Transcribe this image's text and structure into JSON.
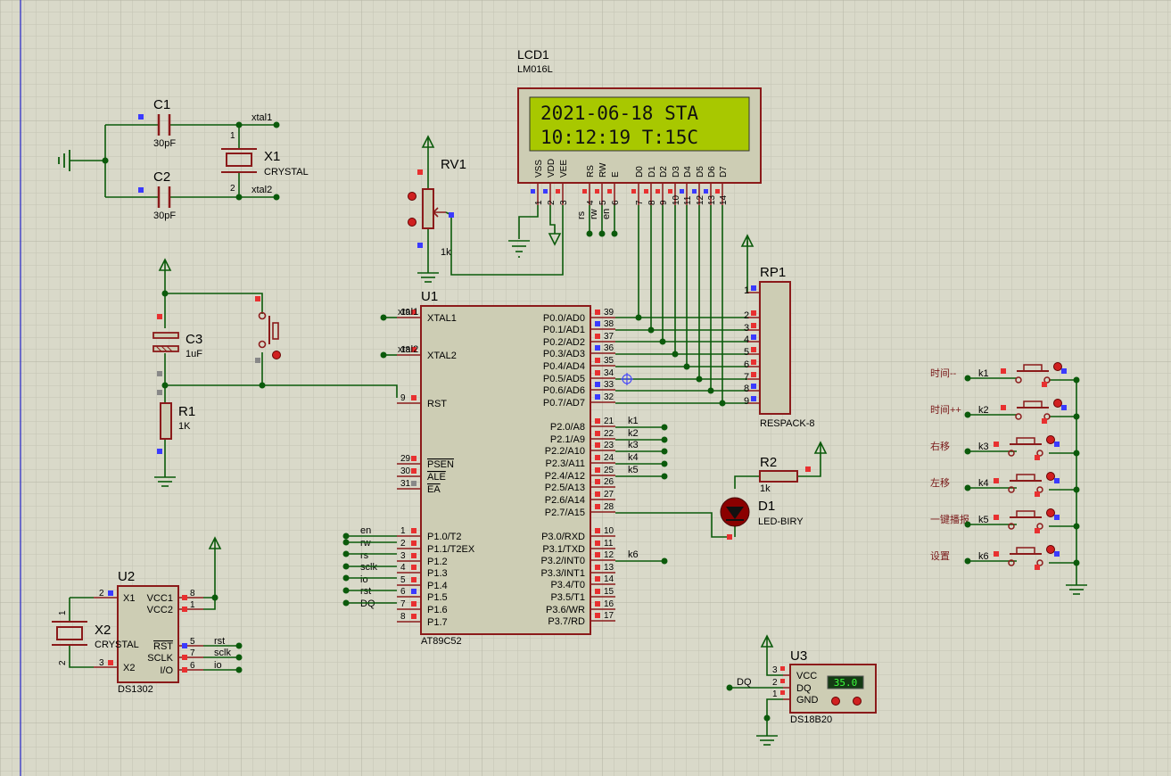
{
  "lcd": {
    "ref": "LCD1",
    "model": "LM016L",
    "line1": "2021-06-18 STA",
    "line2": "10:12:19   T:15C",
    "pin_names": [
      "VSS",
      "VDD",
      "VEE",
      "RS",
      "RW",
      "E",
      "D0",
      "D1",
      "D2",
      "D3",
      "D4",
      "D5",
      "D6",
      "D7"
    ],
    "pin_numbers": [
      "1",
      "2",
      "3",
      "4",
      "5",
      "6",
      "7",
      "8",
      "9",
      "10",
      "11",
      "12",
      "13",
      "14"
    ],
    "net_rs": "rs",
    "net_rw": "rw",
    "net_en": "en"
  },
  "c1": {
    "ref": "C1",
    "value": "30pF"
  },
  "c2": {
    "ref": "C2",
    "value": "30pF"
  },
  "x1": {
    "ref": "X1",
    "value": "CRYSTAL",
    "net1": "xtal1",
    "net2": "xtal2",
    "pin1": "1",
    "pin2": "2"
  },
  "rv1": {
    "ref": "RV1",
    "value": "1k"
  },
  "c3": {
    "ref": "C3",
    "value": "1uF"
  },
  "r1": {
    "ref": "R1",
    "value": "1K"
  },
  "u1": {
    "ref": "U1",
    "part": "AT89C52",
    "left_pins": [
      {
        "name": "XTAL1",
        "num": "19",
        "net": "xtal1"
      },
      {
        "name": "XTAL2",
        "num": "18",
        "net": "xtal2"
      },
      {
        "name": "RST",
        "num": "9",
        "net": ""
      },
      {
        "name": "PSEN",
        "num": "29",
        "net": ""
      },
      {
        "name": "ALE",
        "num": "30",
        "net": ""
      },
      {
        "name": "EA",
        "num": "31",
        "net": ""
      },
      {
        "name": "P1.0/T2",
        "num": "1",
        "net": "en"
      },
      {
        "name": "P1.1/T2EX",
        "num": "2",
        "net": "rw"
      },
      {
        "name": "P1.2",
        "num": "3",
        "net": "rs"
      },
      {
        "name": "P1.3",
        "num": "4",
        "net": "sclk"
      },
      {
        "name": "P1.4",
        "num": "5",
        "net": "io"
      },
      {
        "name": "P1.5",
        "num": "6",
        "net": "rst"
      },
      {
        "name": "P1.6",
        "num": "7",
        "net": "DQ"
      },
      {
        "name": "P1.7",
        "num": "8",
        "net": ""
      }
    ],
    "right_pins": [
      {
        "name": "P0.0/AD0",
        "num": "39",
        "net": ""
      },
      {
        "name": "P0.1/AD1",
        "num": "38",
        "net": ""
      },
      {
        "name": "P0.2/AD2",
        "num": "37",
        "net": ""
      },
      {
        "name": "P0.3/AD3",
        "num": "36",
        "net": ""
      },
      {
        "name": "P0.4/AD4",
        "num": "35",
        "net": ""
      },
      {
        "name": "P0.5/AD5",
        "num": "34",
        "net": ""
      },
      {
        "name": "P0.6/AD6",
        "num": "33",
        "net": ""
      },
      {
        "name": "P0.7/AD7",
        "num": "32",
        "net": ""
      },
      {
        "name": "P2.0/A8",
        "num": "21",
        "net": "k1"
      },
      {
        "name": "P2.1/A9",
        "num": "22",
        "net": "k2"
      },
      {
        "name": "P2.2/A10",
        "num": "23",
        "net": "k3"
      },
      {
        "name": "P2.3/A11",
        "num": "24",
        "net": "k4"
      },
      {
        "name": "P2.4/A12",
        "num": "25",
        "net": "k5"
      },
      {
        "name": "P2.5/A13",
        "num": "26",
        "net": ""
      },
      {
        "name": "P2.6/A14",
        "num": "27",
        "net": ""
      },
      {
        "name": "P2.7/A15",
        "num": "28",
        "net": ""
      },
      {
        "name": "P3.0/RXD",
        "num": "10",
        "net": ""
      },
      {
        "name": "P3.1/TXD",
        "num": "11",
        "net": ""
      },
      {
        "name": "P3.2/INT0",
        "num": "12",
        "net": "k6"
      },
      {
        "name": "P3.3/INT1",
        "num": "13",
        "net": ""
      },
      {
        "name": "P3.4/T0",
        "num": "14",
        "net": ""
      },
      {
        "name": "P3.5/T1",
        "num": "15",
        "net": ""
      },
      {
        "name": "P3.6/WR",
        "num": "16",
        "net": ""
      },
      {
        "name": "P3.7/RD",
        "num": "17",
        "net": ""
      }
    ]
  },
  "rp1": {
    "ref": "RP1",
    "part": "RESPACK-8",
    "pins": [
      "1",
      "2",
      "3",
      "4",
      "5",
      "6",
      "7",
      "8",
      "9"
    ]
  },
  "r2": {
    "ref": "R2",
    "value": "1k"
  },
  "d1": {
    "ref": "D1",
    "part": "LED-BIRY"
  },
  "u2": {
    "ref": "U2",
    "part": "DS1302",
    "left_pins": [
      {
        "name": "X1",
        "num": "2"
      },
      {
        "name": "X2",
        "num": "3"
      }
    ],
    "right_pins": [
      {
        "name": "VCC1",
        "num": "8",
        "net": ""
      },
      {
        "name": "VCC2",
        "num": "1",
        "net": ""
      },
      {
        "name": "RST",
        "num": "5",
        "net": "rst"
      },
      {
        "name": "SCLK",
        "num": "7",
        "net": "sclk"
      },
      {
        "name": "I/O",
        "num": "6",
        "net": "io"
      }
    ]
  },
  "x2": {
    "ref": "X2",
    "value": "CRYSTAL",
    "pin1": "1",
    "pin2": "2"
  },
  "u3": {
    "ref": "U3",
    "part": "DS18B20",
    "reading": "35.0",
    "net": "DQ",
    "pins": [
      {
        "name": "VCC",
        "num": "3"
      },
      {
        "name": "DQ",
        "num": "2"
      },
      {
        "name": "GND",
        "num": "1"
      }
    ]
  },
  "keys": [
    {
      "label": "时间--",
      "net": "k1"
    },
    {
      "label": "时间++",
      "net": "k2"
    },
    {
      "label": "右移",
      "net": "k3"
    },
    {
      "label": "左移",
      "net": "k4"
    },
    {
      "label": "一键播报",
      "net": "k5"
    },
    {
      "label": "设置",
      "net": "k6"
    }
  ],
  "colors": {
    "background": "#d9d9c9",
    "grid": "#c2c2b2",
    "wire": "#0b5a0b",
    "body_outline": "#8b1a1a",
    "body_fill": "#cdcdb4",
    "lcd_screen": "#a8c800",
    "label_dark": "#000000",
    "pin_red": "#e83030",
    "pin_blue": "#3a3aff",
    "left_margin_line": "#2323c8"
  }
}
